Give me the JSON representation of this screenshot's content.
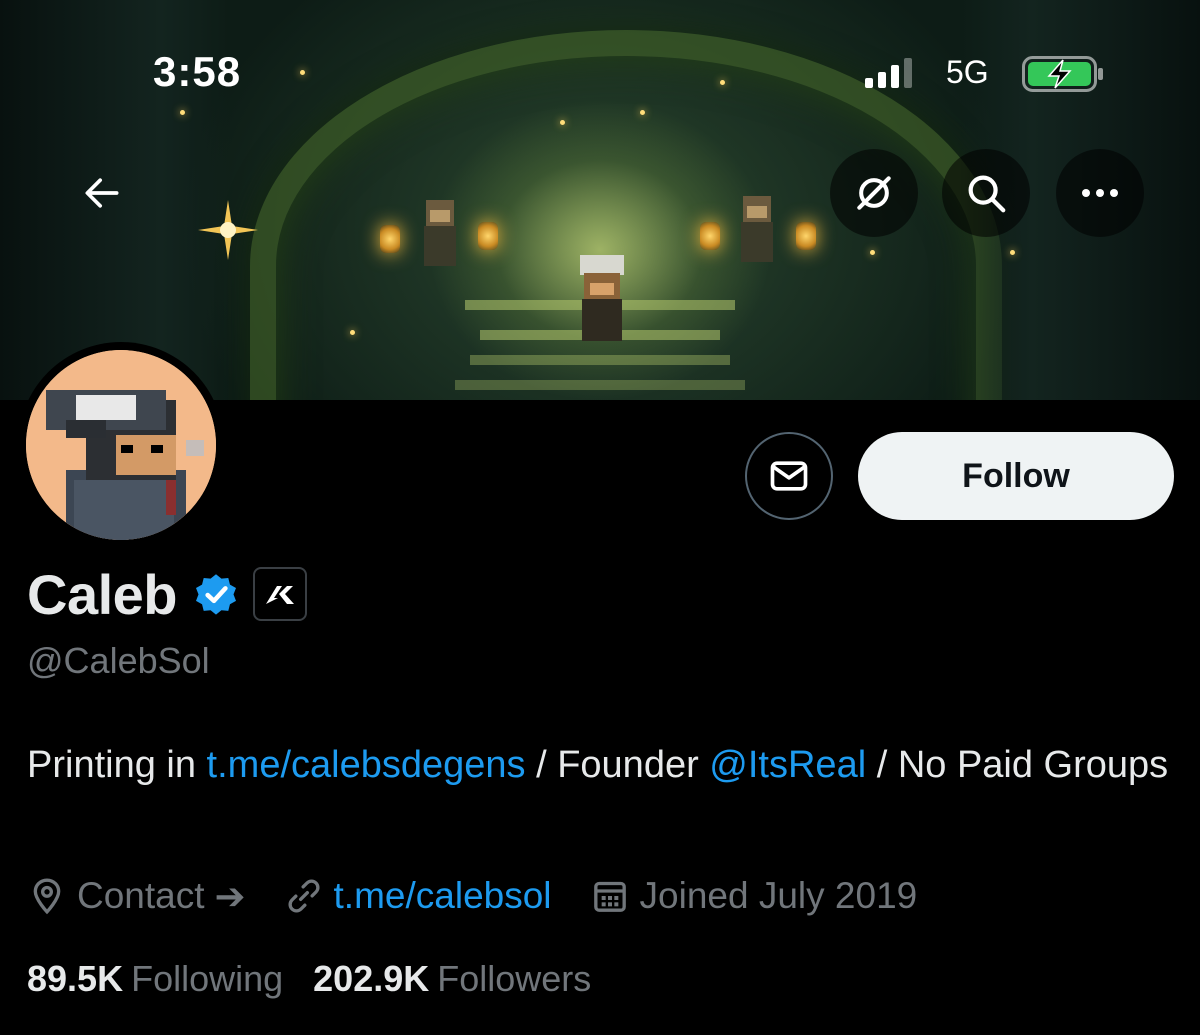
{
  "status_bar": {
    "time": "3:58",
    "network": "5G"
  },
  "header": {
    "icons": [
      "back-arrow-icon",
      "crypto-icon",
      "search-icon",
      "more-icon"
    ]
  },
  "actions": {
    "follow_label": "Follow"
  },
  "profile": {
    "name": "Caleb",
    "handle": "@CalebSol",
    "bio": {
      "part1": "Printing in ",
      "link1": "t.me/calebsdegens",
      "part2": " / Founder ",
      "mention": "@ItsReal",
      "part3": " / No Paid Groups"
    },
    "meta": {
      "contact": "Contact",
      "contact_arrow": "➔",
      "website": "t.me/calebsol",
      "joined": "Joined July 2019"
    },
    "stats": {
      "following_count": "89.5K",
      "following_label": "Following",
      "followers_count": "202.9K",
      "followers_label": "Followers"
    }
  },
  "colors": {
    "background": "#000000",
    "link": "#1d9bf0",
    "secondary_text": "#71767b",
    "primary_text": "#e7e9ea",
    "follow_button": "#eff3f4"
  }
}
